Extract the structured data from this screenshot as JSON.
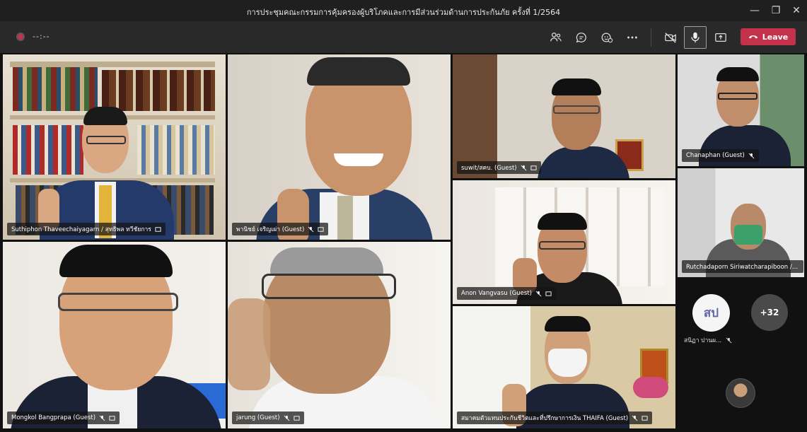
{
  "window": {
    "title": "การประชุมคณะกรรมการคุ้มครองผู้บริโภคและการมีส่วนร่วมด้านการประกันภัย ครั้งที่ 1/2564",
    "minimize_glyph": "—",
    "maximize_glyph": "❐",
    "close_glyph": "✕"
  },
  "toolbar": {
    "timer": "--:--",
    "leave_label": "Leave",
    "icons": [
      "people-icon",
      "chat-icon",
      "reactions-icon",
      "more-icon",
      "camera-off-icon",
      "mic-icon",
      "share-icon"
    ],
    "leave_color": "#c4314b"
  },
  "participants": [
    {
      "name": "Suthiphon Thaveechaiyagarn / สุทธิพล ทวีชัยการ",
      "role": "host-tile"
    },
    {
      "name": "พานิชย์ เจริญเผ่า (Guest)"
    },
    {
      "name": "suwit/สคบ. (Guest)"
    },
    {
      "name": "Chanaphan (Guest)"
    },
    {
      "name": "Anon Vangvasu (Guest)"
    },
    {
      "name": "Rutchadaporn Siriwatcharapiboon / รั..."
    },
    {
      "name": "Mongkol Bangprapa (Guest)"
    },
    {
      "name": "jarung (Guest)"
    },
    {
      "name": "สมาคมตัวแทนประกันชีวิตและที่ปรึกษาการเงิน THAIFA (Guest)"
    }
  ],
  "overflow": {
    "avatar_initials": "สป",
    "avatar_name": "สนิฏา ปานผ...",
    "more_count": "+32"
  }
}
